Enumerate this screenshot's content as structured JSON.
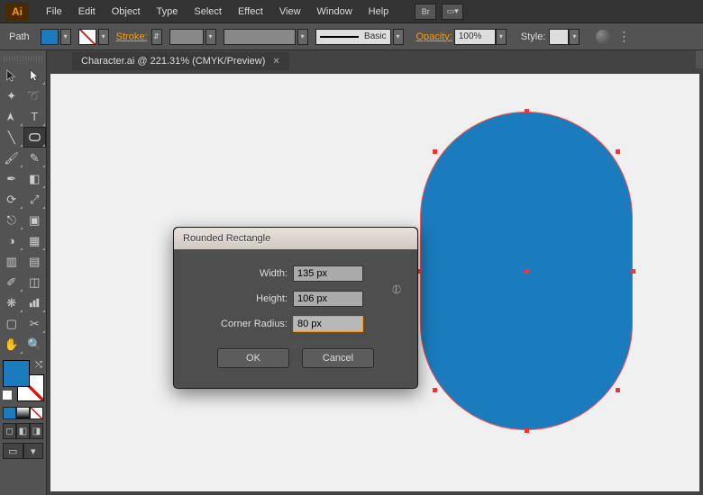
{
  "app": {
    "logo_text": "Ai"
  },
  "menu": {
    "items": [
      "File",
      "Edit",
      "Object",
      "Type",
      "Select",
      "Effect",
      "View",
      "Window",
      "Help"
    ],
    "br_label": "Br"
  },
  "control": {
    "selection_label": "Path",
    "fill_color": "#1a7bbd",
    "stroke_label": "Stroke:",
    "brush_label": "Basic",
    "opacity_label": "Opacity:",
    "opacity_value": "100%",
    "style_label": "Style:"
  },
  "document": {
    "tab_title": "Character.ai @ 221.31% (CMYK/Preview)"
  },
  "dialog": {
    "title": "Rounded Rectangle",
    "width_label": "Width:",
    "width_value": "135 px",
    "height_label": "Height:",
    "height_value": "106 px",
    "radius_label": "Corner Radius:",
    "radius_value": "80 px",
    "ok_label": "OK",
    "cancel_label": "Cancel"
  },
  "shape": {
    "fill": "#1a7bbd"
  }
}
